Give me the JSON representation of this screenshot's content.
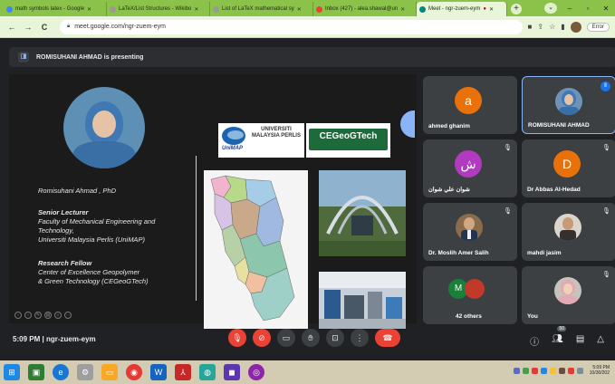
{
  "browser": {
    "tabs": [
      {
        "label": "math symbols latex - Google",
        "color": "#4285f4"
      },
      {
        "label": "LaTeX/List Structures - Wikibo",
        "color": "#777777"
      },
      {
        "label": "List of LaTeX mathematical sy",
        "color": "#777777"
      },
      {
        "label": "Inbox (427) - alea.shawal@un",
        "color": "#ea4335"
      },
      {
        "label": "Meet - ngr-zuem-eym",
        "color": "#00897b"
      }
    ],
    "new_tab": "+",
    "url": "meet.google.com/ngr-zuem-eym",
    "error_label": "Error",
    "nav": {
      "back": "←",
      "forward": "→",
      "reload": "C"
    }
  },
  "meet": {
    "presenting_banner": "ROMISUHANI AHMAD is presenting",
    "slide": {
      "name": "Romisuhani Ahmad , PhD",
      "role_title": "Senior Lecturer",
      "role_line1": "Faculty of Mechanical Engineering and",
      "role_line2": "Technology,",
      "role_line3": "Universiti Malaysia Perlis (UniMAP)",
      "fellow_title": "Research Fellow",
      "fellow_line1": "Center of Excellence Geopolymer",
      "fellow_line2": "& Green Technology (CEGeoGTech)",
      "logo1_text": "UNIVERSITI MALAYSIA PERLIS",
      "logo1_brand": "UniMAP",
      "logo2_text": "CEGeoGTech"
    },
    "participants": [
      {
        "name": "ahmed ghanim",
        "initial": "a",
        "color": "#e8710a",
        "muted": false
      },
      {
        "name": "ROMISUHANI AHMAD",
        "initial": "",
        "color": "",
        "muted": false,
        "speaking": true
      },
      {
        "name": "شوان علي شوان",
        "initial": "ش",
        "color": "#b23ac0",
        "muted": true
      },
      {
        "name": "Dr Abbas Al-Hedad",
        "initial": "D",
        "color": "#e8710a",
        "muted": true
      },
      {
        "name": "Dr. Moslih Amer Salih",
        "initial": "",
        "color": "",
        "muted": true
      },
      {
        "name": "mahdi jasim",
        "initial": "",
        "color": "",
        "muted": true
      },
      {
        "name": "42 others",
        "initial": "M",
        "color": "#188038",
        "muted": false
      },
      {
        "name": "You",
        "initial": "",
        "color": "",
        "muted": true
      }
    ],
    "bottom": {
      "time": "5:09 PM",
      "separator": "|",
      "meeting_code": "ngr-zuem-eym",
      "participant_count": "50"
    }
  },
  "taskbar": {
    "clock_time": "5:09 PM",
    "clock_date": "10/30/202"
  }
}
